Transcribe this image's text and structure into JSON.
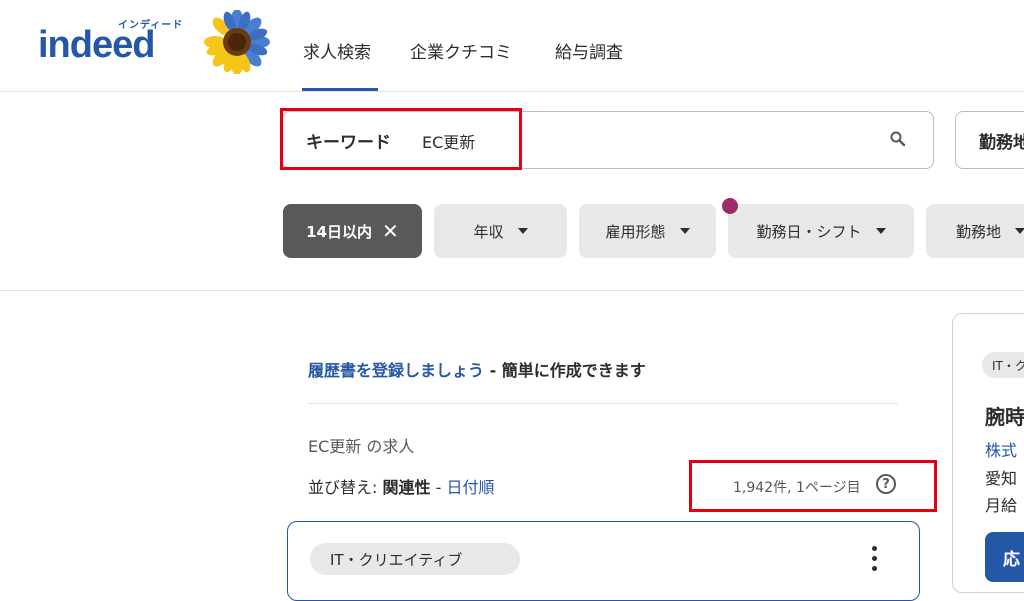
{
  "header": {
    "logo_kana": "インディード",
    "logo_text": "indeed",
    "nav": [
      {
        "label": "求人検索",
        "active": true
      },
      {
        "label": "企業クチコミ",
        "active": false
      },
      {
        "label": "給与調査",
        "active": false
      }
    ]
  },
  "search": {
    "keyword_label": "キーワード",
    "keyword_value": "EC更新",
    "location_label": "勤務地"
  },
  "filters": [
    {
      "label": "14日以内",
      "active": true
    },
    {
      "label": "年収",
      "active": false
    },
    {
      "label": "雇用形態",
      "active": false
    },
    {
      "label": "勤務日・シフト",
      "active": false
    },
    {
      "label": "勤務地",
      "active": false
    }
  ],
  "results": {
    "resume_link": "履歴書を登録しましょう",
    "resume_rest": " - 簡単に作成できます",
    "heading": "EC更新 の求人",
    "sort_prefix": "並び替え: ",
    "sort_relevance": "関連性",
    "sort_sep": " - ",
    "sort_date": "日付順",
    "count": "1,942件, 1ページ目",
    "help_symbol": "?"
  },
  "job_card": {
    "tag": "IT・クリエイティブ"
  },
  "side_card": {
    "tag": "IT・ク",
    "title": "腕時",
    "company": "株式",
    "location": "愛知",
    "salary": "月給",
    "apply": "応"
  },
  "colors": {
    "brand_blue": "#2557a7",
    "highlight_red": "#e4000f",
    "active_filter": "#595959",
    "notification_dot": "#9d2b6b"
  }
}
